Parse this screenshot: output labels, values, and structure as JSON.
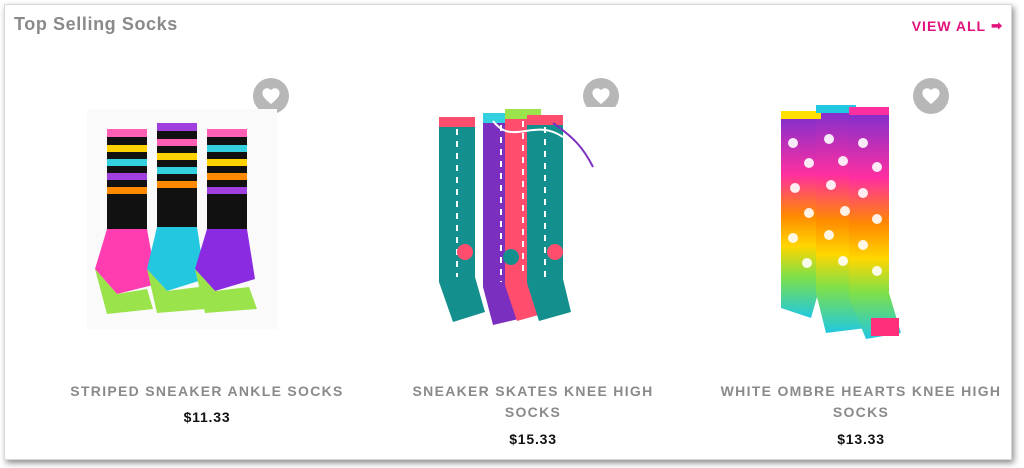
{
  "section": {
    "title": "Top Selling Socks",
    "view_all_label": "VIEW ALL",
    "view_all_icon": "arrow-right-icon",
    "accent_color": "#e3117b"
  },
  "products": [
    {
      "name": "STRIPED SNEAKER ANKLE SOCKS",
      "price": "$11.33",
      "icon": "heart-icon"
    },
    {
      "name": "SNEAKER SKATES KNEE HIGH SOCKS",
      "price": "$15.33",
      "icon": "heart-icon"
    },
    {
      "name": "WHITE OMBRE HEARTS KNEE HIGH SOCKS",
      "price": "$13.33",
      "icon": "heart-icon"
    }
  ]
}
